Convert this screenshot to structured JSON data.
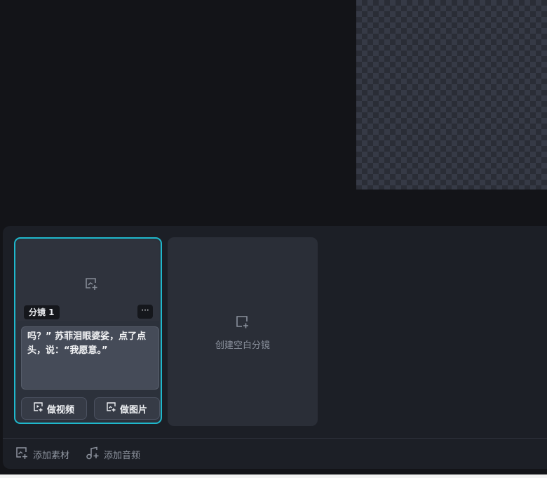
{
  "scene_card": {
    "tag": "分镜 1",
    "more": "···",
    "script_text": "吗？” 苏菲泪眼婆娑，点了点头，说：“我愿意。”",
    "make_video": "做视频",
    "make_image": "做图片"
  },
  "blank_card": {
    "label": "创建空白分镜"
  },
  "bottom_bar": {
    "add_material": "添加素材",
    "add_audio": "添加音频"
  },
  "colors": {
    "accent": "#1fb8cc",
    "background": "#131418",
    "panel": "#1c1f26"
  },
  "icons": [
    "image-add-icon",
    "video-add-icon",
    "square-add-icon",
    "music-icon"
  ]
}
